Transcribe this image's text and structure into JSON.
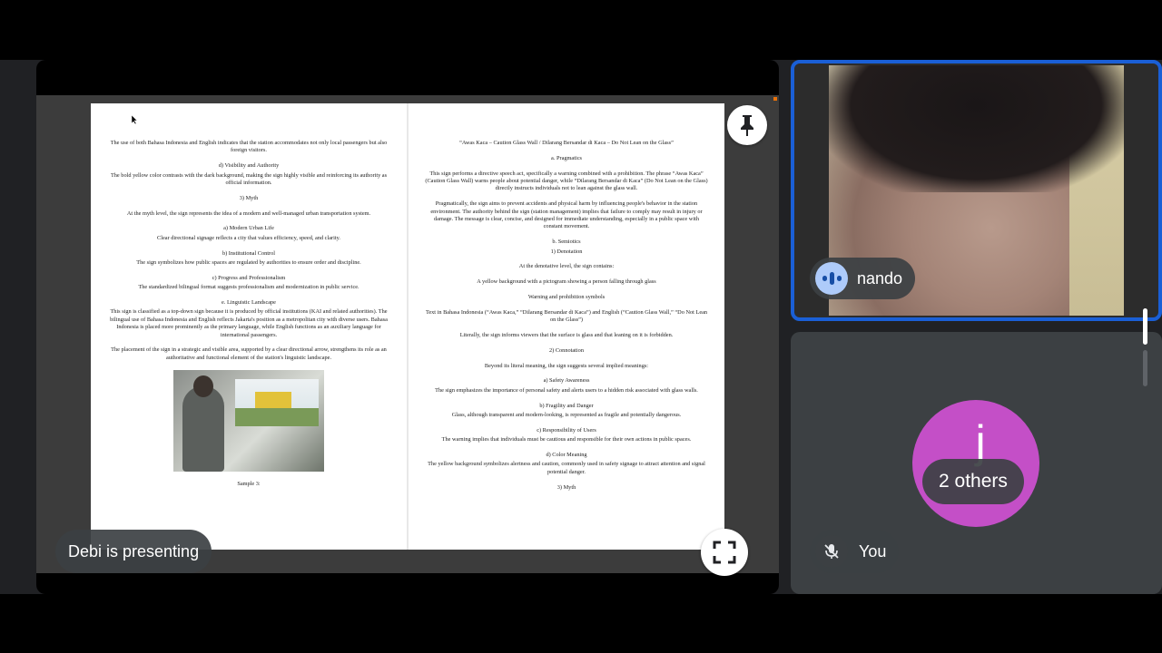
{
  "presentation": {
    "presenting_label": "Debi is presenting",
    "left_page": {
      "paragraphs": [
        "The use of both Bahasa Indonesia and English indicates that the station accommodates not only local passengers but also foreign visitors.",
        "d) Visibility and Authority",
        "The bold yellow color contrasts with the dark background, making the sign highly visible and reinforcing its authority as official information.",
        "3) Myth",
        "At the myth level, the sign represents the idea of a modern and well-managed urban transportation system.",
        "a) Modern Urban Life",
        "Clear directional signage reflects a city that values efficiency, speed, and clarity.",
        "b) Institutional Control",
        "The sign symbolizes how public spaces are regulated by authorities to ensure order and discipline.",
        "c) Progress and Professionalism",
        "The standardized bilingual format suggests professionalism and modernization in public service.",
        "e. Linguistic Landscape",
        "This sign is classified as a top-down sign because it is produced by official institutions (KAI and related authorities). The bilingual use of Bahasa Indonesia and English reflects Jakarta's position as a metropolitan city with diverse users. Bahasa Indonesia is placed more prominently as the primary language, while English functions as an auxiliary language for international passengers.",
        "The placement of the sign in a strategic and visible area, supported by a clear directional arrow, strengthens its role as an authoritative and functional element of the station's linguistic landscape."
      ],
      "caption": "Sample 3:"
    },
    "right_page": {
      "paragraphs": [
        "“Awas Kaca – Caution Glass Wall / Dilarang Bersandar di Kaca – Do Not Lean on the Glass”",
        "a. Pragmatics",
        "This sign performs a directive speech act, specifically a warning combined with a prohibition. The phrase “Awas Kaca” (Caution Glass Wall) warns people about potential danger, while “Dilarang Bersandar di Kaca” (Do Not Lean on the Glass) directly instructs individuals not to lean against the glass wall.",
        "Pragmatically, the sign aims to prevent accidents and physical harm by influencing people's behavior in the station environment. The authority behind the sign (station management) implies that failure to comply may result in injury or damage. The message is clear, concise, and designed for immediate understanding, especially in a public space with constant movement.",
        "b. Semiotics",
        "1) Denotation",
        "At the denotative level, the sign contains:",
        "A yellow background with a pictogram showing a person falling through glass",
        "Warning and prohibition symbols",
        "Text in Bahasa Indonesia (“Awas Kaca,” “Dilarang Bersandar di Kaca”) and English (“Caution Glass Wall,” “Do Not Lean on the Glass”)",
        "Literally, the sign informs viewers that the surface is glass and that leaning on it is forbidden.",
        "2) Connotation",
        "Beyond its literal meaning, the sign suggests several implied meanings:",
        "a) Safety Awareness",
        "The sign emphasizes the importance of personal safety and alerts users to a hidden risk associated with glass walls.",
        "b) Fragility and Danger",
        "Glass, although transparent and modern-looking, is represented as fragile and potentially dangerous.",
        "c) Responsibility of Users",
        "The warning implies that individuals must be cautious and responsible for their own actions in public spaces.",
        "d) Color Meaning",
        "The yellow background symbolizes alertness and caution, commonly used in safety signage to attract attention and signal potential danger.",
        "3) Myth"
      ]
    },
    "icons": {
      "pin": "pin-icon",
      "fullscreen": "fullscreen-icon"
    }
  },
  "participants": {
    "nando": {
      "name": "nando",
      "icon": "speaking-indicator-icon",
      "border_color": "#1a5fd6"
    },
    "others": {
      "avatar_letter": "j",
      "label": "2 others",
      "avatar_color": "#c44fc7"
    },
    "you": {
      "name": "You",
      "icon": "mic-off-icon"
    }
  }
}
